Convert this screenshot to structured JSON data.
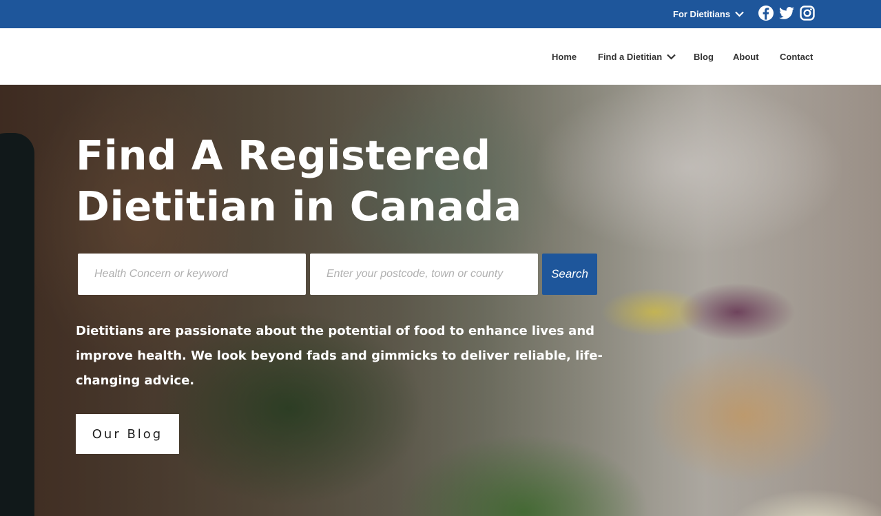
{
  "colors": {
    "brand_blue": "#1e569b",
    "text_dark": "#333333",
    "white": "#ffffff"
  },
  "topbar": {
    "for_dietitians_label": "For Dietitians",
    "dropdown_icon": "chevron-down-icon",
    "social": [
      {
        "name": "facebook-icon"
      },
      {
        "name": "twitter-icon"
      },
      {
        "name": "instagram-icon"
      }
    ]
  },
  "nav": {
    "items": [
      {
        "label": "Home"
      },
      {
        "label": "Find a Dietitian",
        "has_dropdown": true
      },
      {
        "label": "Blog"
      },
      {
        "label": "About"
      },
      {
        "label": "Contact"
      }
    ]
  },
  "hero": {
    "title_line1": "Find A Registered",
    "title_line2": "Dietitian in Canada",
    "search": {
      "keyword_placeholder": "Health Concern or keyword",
      "keyword_value": "",
      "location_placeholder": "Enter your postcode, town or county",
      "location_value": "",
      "button_label": "Search"
    },
    "description": "Dietitians are passionate about the potential of food to enhance lives and improve health. We look beyond fads and gimmicks to deliver reliable, life-changing advice.",
    "blog_button_label": "Our Blog"
  }
}
